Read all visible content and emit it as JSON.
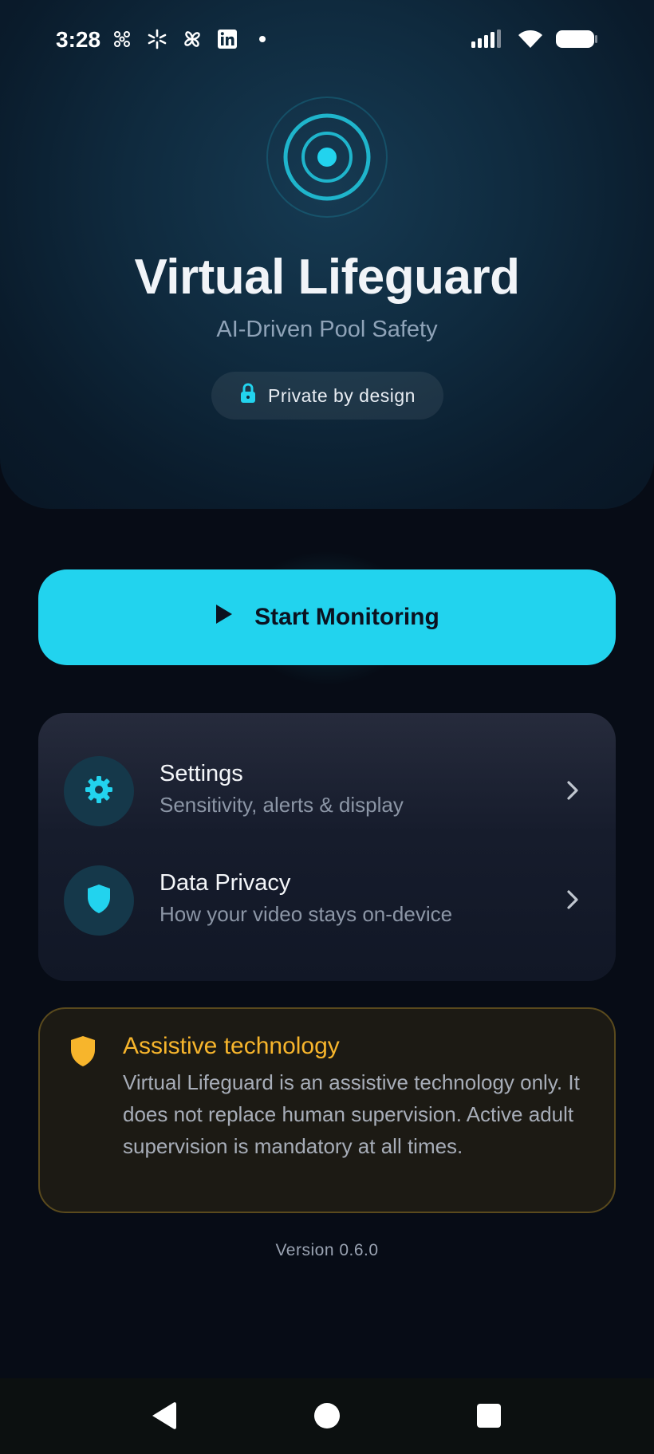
{
  "status_bar": {
    "time": "3:28",
    "left_icons": [
      "pinwheel-icon",
      "sparkle-icon",
      "fan-icon",
      "linkedin-icon",
      "dot-icon"
    ],
    "right_icons": [
      "signal-icon",
      "wifi-icon",
      "battery-icon"
    ]
  },
  "hero": {
    "logo_icon": "radar-icon",
    "title": "Virtual Lifeguard",
    "subtitle": "AI-Driven Pool Safety",
    "badge_icon": "lock-icon",
    "badge_label": "Private by design"
  },
  "cta": {
    "icon": "play-icon",
    "label": "Start Monitoring"
  },
  "menu": {
    "items": [
      {
        "icon": "gear-icon",
        "title": "Settings",
        "subtitle": "Sensitivity, alerts & display"
      },
      {
        "icon": "shield-icon",
        "title": "Data Privacy",
        "subtitle": "How your video stays on-device"
      }
    ]
  },
  "disclaimer": {
    "icon": "shield-icon",
    "title": "Assistive technology",
    "body": "Virtual Lifeguard is an assistive technology only. It does not replace human supervision. Active adult supervision is mandatory at all times."
  },
  "version": "Version 0.6.0",
  "nav_bar": {
    "buttons": [
      "back-icon",
      "home-icon",
      "recents-icon"
    ]
  },
  "colors": {
    "accent": "#22d3ee",
    "warning": "#f7b52c",
    "background": "#070c16"
  }
}
